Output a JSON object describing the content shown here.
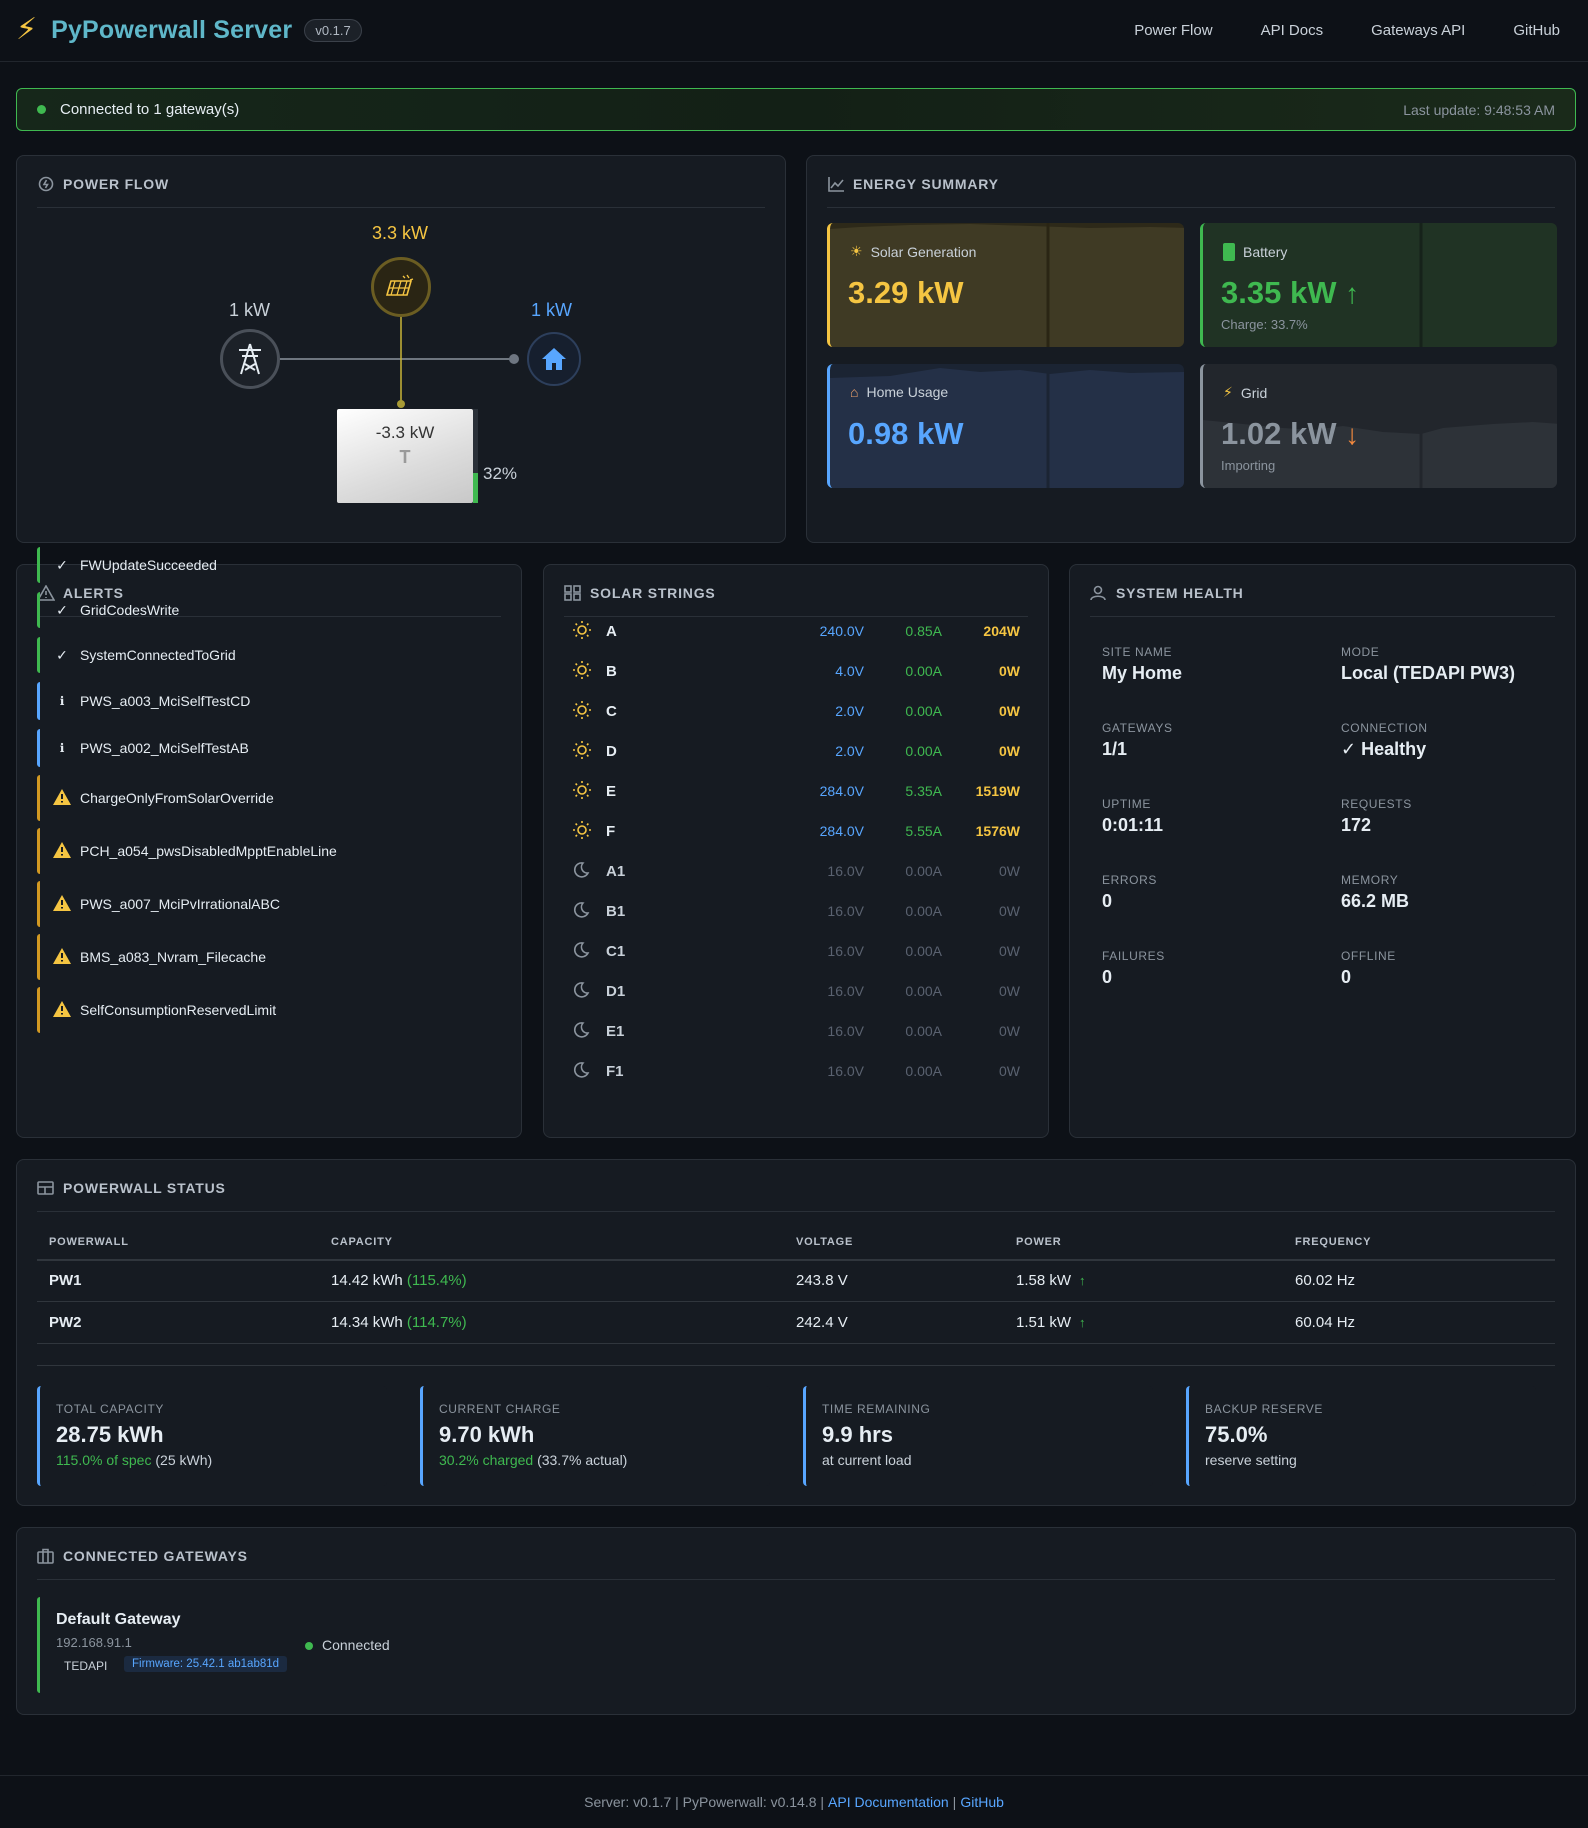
{
  "header": {
    "brand": "PyPowerwall Server",
    "version": "v0.1.7",
    "nav": [
      "Power Flow",
      "API Docs",
      "Gateways API",
      "GitHub"
    ]
  },
  "banner": {
    "message": "Connected to 1 gateway(s)",
    "last_update": "Last update: 9:48:53 AM"
  },
  "power_flow": {
    "title": "POWER FLOW",
    "solar_value": "3.3 kW",
    "grid_value": "1 kW",
    "home_value": "1 kW",
    "battery_value": "-3.3 kW",
    "battery_pct": "32%",
    "battery_level": 0.32
  },
  "energy_summary": {
    "title": "ENERGY SUMMARY",
    "solar": {
      "label": "Solar Generation",
      "value": "3.29 kW"
    },
    "battery": {
      "label": "Battery",
      "value": "3.35 kW",
      "sub": "Charge: 33.7%"
    },
    "home": {
      "label": "Home Usage",
      "value": "0.98 kW"
    },
    "grid": {
      "label": "Grid",
      "value": "1.02 kW",
      "sub": "Importing"
    }
  },
  "alerts": {
    "title": "ALERTS",
    "items": [
      {
        "name": "FWUpdateSucceeded",
        "level": "ok"
      },
      {
        "name": "GridCodesWrite",
        "level": "ok"
      },
      {
        "name": "SystemConnectedToGrid",
        "level": "ok"
      },
      {
        "name": "PWS_a003_MciSelfTestCD",
        "level": "info"
      },
      {
        "name": "PWS_a002_MciSelfTestAB",
        "level": "info"
      },
      {
        "name": "ChargeOnlyFromSolarOverride",
        "level": "warn"
      },
      {
        "name": "PCH_a054_pwsDisabledMpptEnableLine",
        "level": "warn"
      },
      {
        "name": "PWS_a007_MciPvIrrationalABC",
        "level": "warn"
      },
      {
        "name": "BMS_a083_Nvram_Filecache",
        "level": "warn"
      },
      {
        "name": "SelfConsumptionReservedLimit",
        "level": "warn"
      }
    ]
  },
  "solar_strings": {
    "title": "SOLAR STRINGS",
    "rows": [
      {
        "name": "A",
        "voltage": "240.0V",
        "current": "0.85A",
        "power": "204W",
        "active": true
      },
      {
        "name": "B",
        "voltage": "4.0V",
        "current": "0.00A",
        "power": "0W",
        "active": true
      },
      {
        "name": "C",
        "voltage": "2.0V",
        "current": "0.00A",
        "power": "0W",
        "active": true
      },
      {
        "name": "D",
        "voltage": "2.0V",
        "current": "0.00A",
        "power": "0W",
        "active": true
      },
      {
        "name": "E",
        "voltage": "284.0V",
        "current": "5.35A",
        "power": "1519W",
        "active": true
      },
      {
        "name": "F",
        "voltage": "284.0V",
        "current": "5.55A",
        "power": "1576W",
        "active": true
      },
      {
        "name": "A1",
        "voltage": "16.0V",
        "current": "0.00A",
        "power": "0W",
        "active": false
      },
      {
        "name": "B1",
        "voltage": "16.0V",
        "current": "0.00A",
        "power": "0W",
        "active": false
      },
      {
        "name": "C1",
        "voltage": "16.0V",
        "current": "0.00A",
        "power": "0W",
        "active": false
      },
      {
        "name": "D1",
        "voltage": "16.0V",
        "current": "0.00A",
        "power": "0W",
        "active": false
      },
      {
        "name": "E1",
        "voltage": "16.0V",
        "current": "0.00A",
        "power": "0W",
        "active": false
      },
      {
        "name": "F1",
        "voltage": "16.0V",
        "current": "0.00A",
        "power": "0W",
        "active": false
      }
    ]
  },
  "system_health": {
    "title": "SYSTEM HEALTH",
    "items": [
      {
        "label": "SITE NAME",
        "value": "My Home"
      },
      {
        "label": "MODE",
        "value": "Local (TEDAPI PW3)"
      },
      {
        "label": "GATEWAYS",
        "value": "1/1"
      },
      {
        "label": "CONNECTION",
        "value": "✓ Healthy"
      },
      {
        "label": "UPTIME",
        "value": "0:01:11"
      },
      {
        "label": "REQUESTS",
        "value": "172"
      },
      {
        "label": "ERRORS",
        "value": "0"
      },
      {
        "label": "MEMORY",
        "value": "66.2 MB"
      },
      {
        "label": "FAILURES",
        "value": "0"
      },
      {
        "label": "OFFLINE",
        "value": "0"
      }
    ]
  },
  "powerwall_status": {
    "title": "POWERWALL STATUS",
    "columns": [
      "POWERWALL",
      "CAPACITY",
      "VOLTAGE",
      "POWER",
      "FREQUENCY"
    ],
    "rows": [
      {
        "name": "PW1",
        "capacity": "14.42 kWh",
        "capacity_pct": "(115.4%)",
        "voltage": "243.8 V",
        "power": "1.58 kW",
        "frequency": "60.02 Hz"
      },
      {
        "name": "PW2",
        "capacity": "14.34 kWh",
        "capacity_pct": "(114.7%)",
        "voltage": "242.4 V",
        "power": "1.51 kW",
        "frequency": "60.04 Hz"
      }
    ],
    "stats": [
      {
        "label": "TOTAL CAPACITY",
        "value": "28.75 kWh",
        "sub_green": "115.0% of spec",
        "sub": " (25 kWh)"
      },
      {
        "label": "CURRENT CHARGE",
        "value": "9.70 kWh",
        "sub_green": "30.2% charged",
        "sub": " (33.7% actual)"
      },
      {
        "label": "TIME REMAINING",
        "value": "9.9 hrs",
        "sub_green": "",
        "sub": "at current load"
      },
      {
        "label": "BACKUP RESERVE",
        "value": "75.0%",
        "sub_green": "",
        "sub": "reserve setting"
      }
    ]
  },
  "gateways": {
    "title": "CONNECTED GATEWAYS",
    "name": "Default Gateway",
    "ip": "192.168.91.1",
    "type": "TEDAPI",
    "firmware": "Firmware: 25.42.1 ab1ab81d",
    "status": "Connected"
  },
  "footer": {
    "prefix": "Server: v0.1.7 | PyPowerwall: v0.14.8 |",
    "api_link": "API Documentation",
    "sep": "|",
    "github_link": "GitHub"
  },
  "colors": {
    "solar": "#f5c542",
    "battery": "#3fb950",
    "home": "#58a6ff",
    "grid_warn": "#f0883e",
    "info": "#58a6ff",
    "warn": "#d29922"
  }
}
